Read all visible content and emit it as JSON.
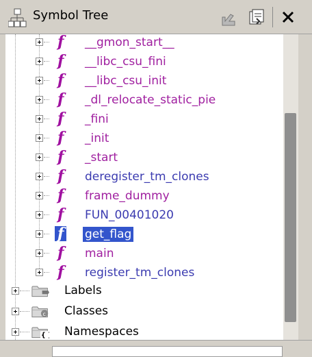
{
  "window": {
    "title": "Symbol Tree"
  },
  "colors": {
    "function_magenta": "#a020a0",
    "function_blue": "#3b3bb0",
    "selected_bg": "#3355cc"
  },
  "functions": [
    {
      "label": "__gmon_start__",
      "color": "magenta",
      "selected": false
    },
    {
      "label": "__libc_csu_fini",
      "color": "magenta",
      "selected": false
    },
    {
      "label": "__libc_csu_init",
      "color": "magenta",
      "selected": false
    },
    {
      "label": "_dl_relocate_static_pie",
      "color": "magenta",
      "selected": false
    },
    {
      "label": "_fini",
      "color": "magenta",
      "selected": false
    },
    {
      "label": "_init",
      "color": "magenta",
      "selected": false
    },
    {
      "label": "_start",
      "color": "magenta",
      "selected": false
    },
    {
      "label": "deregister_tm_clones",
      "color": "blue",
      "selected": false
    },
    {
      "label": "frame_dummy",
      "color": "magenta",
      "selected": false
    },
    {
      "label": "FUN_00401020",
      "color": "blue",
      "selected": false
    },
    {
      "label": "get_flag",
      "color": "white",
      "selected": true
    },
    {
      "label": "main",
      "color": "magenta",
      "selected": false
    },
    {
      "label": "register_tm_clones",
      "color": "blue",
      "selected": false
    }
  ],
  "folders": [
    {
      "label": "Labels",
      "icon": "labels-folder-icon"
    },
    {
      "label": "Classes",
      "icon": "classes-folder-icon"
    },
    {
      "label": "Namespaces",
      "icon": "namespaces-folder-icon"
    }
  ],
  "func_icon_glyph": "f"
}
